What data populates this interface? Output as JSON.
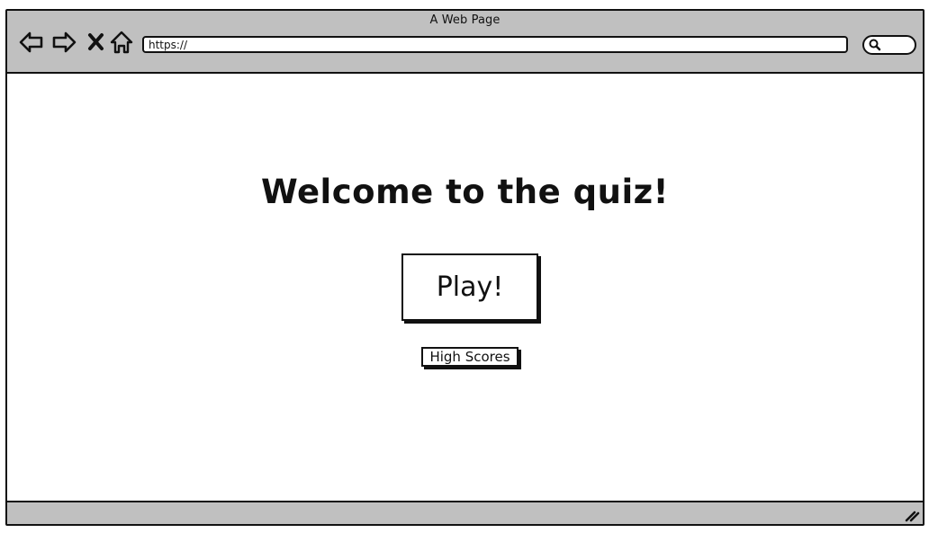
{
  "window": {
    "title": "A Web Page"
  },
  "browser": {
    "address": "https://",
    "icons": {
      "back": "back-arrow-icon",
      "forward": "forward-arrow-icon",
      "close": "close-icon",
      "home": "home-icon",
      "search": "search-icon",
      "resize": "resize-handle-icon"
    }
  },
  "page": {
    "heading": "Welcome to the quiz!",
    "play_label": "Play!",
    "high_scores_label": "High Scores"
  },
  "colors": {
    "chrome": "#c0c0c0",
    "ink": "#111111",
    "background": "#ffffff"
  }
}
